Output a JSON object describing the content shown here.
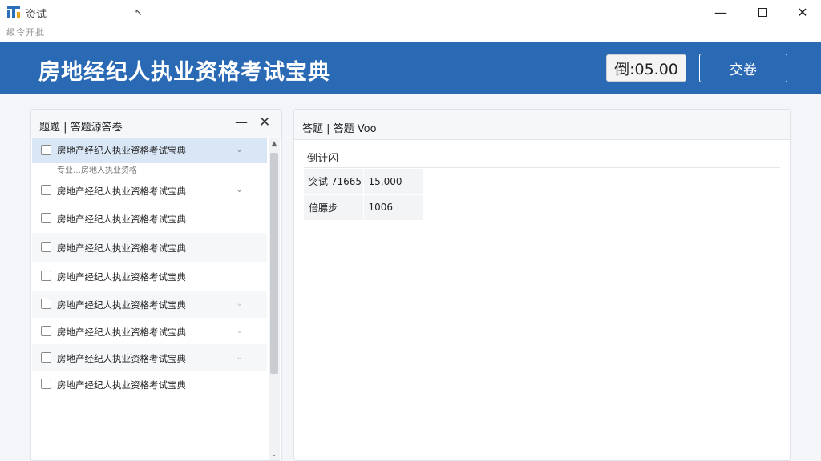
{
  "window": {
    "title": "资试",
    "menu_text": "级令开批",
    "cursor_glyph": "↖",
    "controls": {
      "minimize": "—",
      "close": "✕"
    }
  },
  "header": {
    "title": "房地经纪人执业资格考试宝典",
    "timer": "倒:05.00",
    "submit_label": "交卷",
    "background_color": "#2a6ab5"
  },
  "left_panel": {
    "title": "题题 | 答题源答卷",
    "minimize_glyph": "—",
    "close_glyph": "✕",
    "questions": [
      {
        "label": "房地产经纪人执业资格考试宝典",
        "sub": "专业…房地人执业资格",
        "chevron": "⌄",
        "selected": true
      },
      {
        "label": "房地产经纪人执业资格考试宝典",
        "chevron": "⌄"
      },
      {
        "label": "房地产经纪人执业资格考试宝典"
      },
      {
        "label": "房地产经纪人执业资格考试宝典"
      },
      {
        "label": "房地产经纪人执业资格考试宝典"
      },
      {
        "label": "房地产经纪人执业资格考试宝典",
        "chevron": "⌄"
      },
      {
        "label": "房地产经纪人执业资格考试宝典",
        "chevron": "⌄"
      },
      {
        "label": "房地产经纪人执业资格考试宝典",
        "chevron": "⌄"
      },
      {
        "label": "房地产经纪人执业资格考试宝典"
      }
    ],
    "scroll_up": "▲",
    "scroll_down": "⌄"
  },
  "right_panel": {
    "title": "答题 | 答题 Voo",
    "section_title": "倒计闪",
    "rows": [
      {
        "key": "突试 71665",
        "value": "15,000"
      },
      {
        "key": "倍膘步",
        "value": "1006"
      }
    ]
  },
  "colors": {
    "accent": "#2a6ab5",
    "selected_row": "#d9e6f5",
    "icon_accent": "#e8a21c"
  }
}
